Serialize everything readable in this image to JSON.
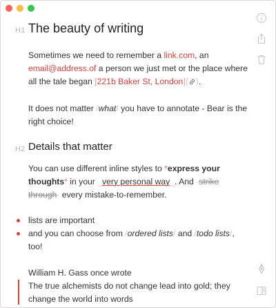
{
  "window": {
    "controls": {
      "close_color": "#fc605c",
      "minimize_color": "#fdbc40",
      "zoom_color": "#34c84a"
    }
  },
  "doc": {
    "h1_marker": "H1",
    "h1_title": "The beauty of writing",
    "p1": {
      "t1": "Sometimes we need to remember a ",
      "link": "link.com",
      "t2": ", an",
      "email": "email@address.of",
      "t3": " a person we just met or the place where all the tale began ",
      "open_bracket": "[",
      "place": "221b Baker St, London",
      "close_bracket": "]",
      "chip_open": "(",
      "chip_close": ")",
      "t4": "."
    },
    "p2": {
      "t1": "It does not matter ",
      "slash_open": "/",
      "what": "what",
      "slash_close": "/",
      "t2": " you have to annotate - Bear is the right choice!"
    },
    "h2_marker": "H2",
    "h2_title": "Details that matter",
    "p3": {
      "t1": "You can use different inline styles to ",
      "star_open": "*",
      "bold": "express your thoughts",
      "star_close": "*",
      "t2": " in your ",
      "u_open": "_",
      "underlined": "very personal way",
      "u_close": "_",
      "t3": ". And ",
      "s_open": "-",
      "strike": "strike through",
      "s_close": "-",
      "t4": " every mistake-to-remember."
    },
    "list": {
      "item1": "lists are important",
      "item2": {
        "t1": "and you can choose from ",
        "slash1_open": "/",
        "ordered": "ordered lists",
        "slash1_close": "/",
        "t2": " and ",
        "slash2_open": "/",
        "todo": "todo lists",
        "slash2_close": "/",
        "t3": ", too!"
      }
    },
    "quote_intro": "William H. Gass once wrote",
    "quote": "The true alchemists do not change lead into gold; they change the world into words"
  },
  "sidebar": {
    "icons": [
      "info-icon",
      "share-icon",
      "trash-icon",
      "pen-icon",
      "sidebar-toggle-icon"
    ]
  },
  "colors": {
    "accent": "#d4403a"
  }
}
